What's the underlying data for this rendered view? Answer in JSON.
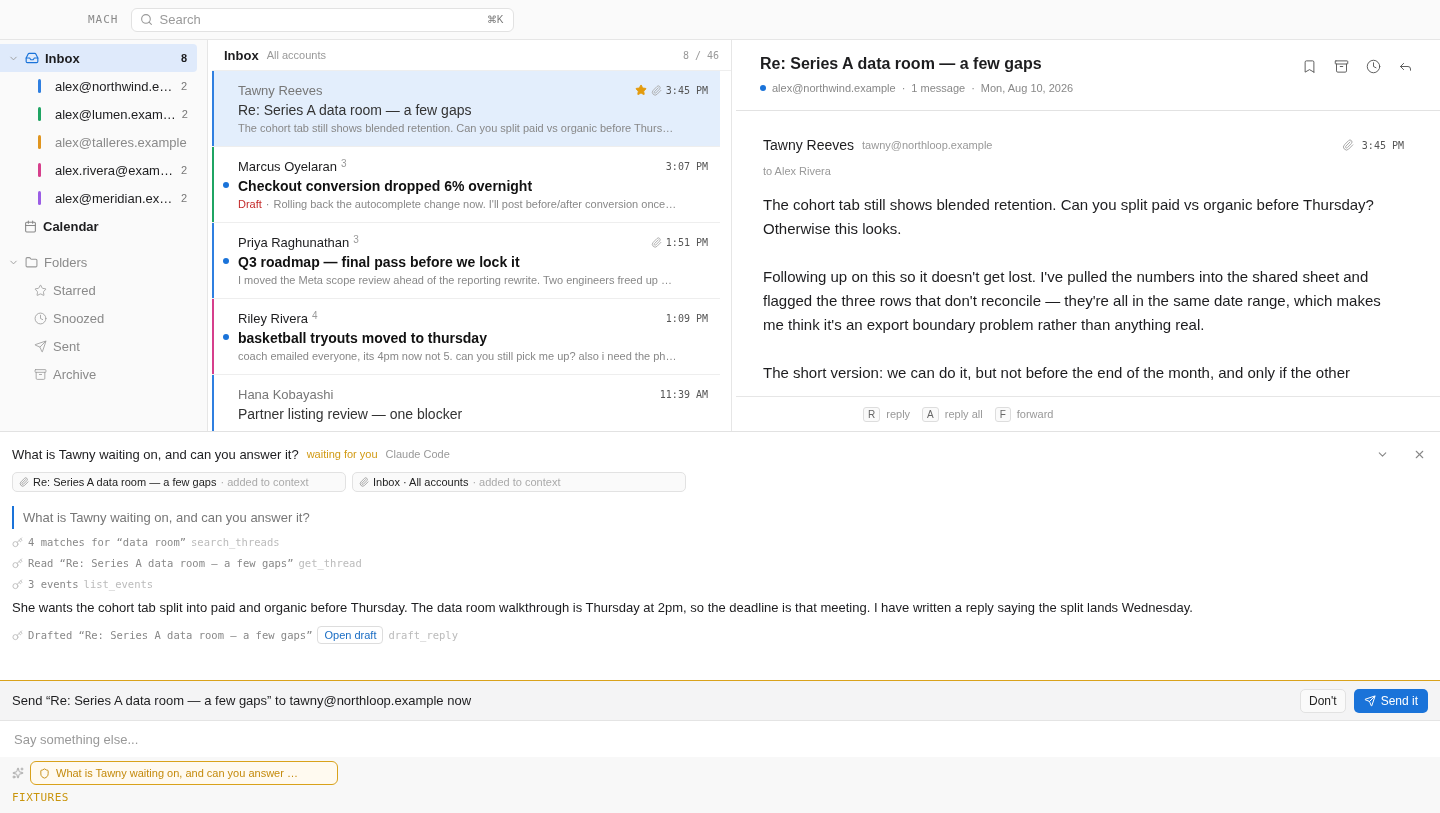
{
  "app": {
    "name": "MACH"
  },
  "search": {
    "placeholder": "Search",
    "shortcut": "⌘K"
  },
  "sidebar": {
    "inbox": {
      "label": "Inbox",
      "count": "8",
      "expanded": true,
      "selected": true
    },
    "accounts": [
      {
        "label": "alex@northwind.e…",
        "count": "2",
        "color": "#2f7fe0",
        "unread": true
      },
      {
        "label": "alex@lumen.exam…",
        "count": "2",
        "color": "#1fa463",
        "unread": true
      },
      {
        "label": "alex@talleres.example",
        "color": "#e0951f",
        "unread": false
      },
      {
        "label": "alex.rivera@exam…",
        "count": "2",
        "color": "#d63f8c",
        "unread": true
      },
      {
        "label": "alex@meridian.ex…",
        "count": "2",
        "color": "#9b5de5",
        "unread": true
      }
    ],
    "calendar": {
      "label": "Calendar"
    },
    "folders": {
      "label": "Folders",
      "expanded": true,
      "items": [
        {
          "kind": "starred",
          "label": "Starred"
        },
        {
          "kind": "snoozed",
          "label": "Snoozed"
        },
        {
          "kind": "sent",
          "label": "Sent"
        },
        {
          "kind": "archive",
          "label": "Archive"
        }
      ]
    }
  },
  "list": {
    "title": "Inbox",
    "scope": "All accounts",
    "counter": "8 / 46",
    "threads": [
      {
        "sender": "Tawny Reeves",
        "time": "3:45 PM",
        "subject": "Re: Series A data room — a few gaps",
        "preview": "The cohort tab still shows blended retention. Can you split paid vs organic before Thurs…",
        "starred": true,
        "attachment": true,
        "unread": false,
        "selected": true,
        "color": "#2f7fe0"
      },
      {
        "sender": "Marcus Oyelaran",
        "count": "3",
        "time": "3:07 PM",
        "subject": "Checkout conversion dropped 6% overnight",
        "draft_label": "Draft",
        "draft_separator": "·",
        "preview": "Rolling back the autocomplete change now. I'll post before/after conversion once…",
        "starred": false,
        "attachment": false,
        "unread": true,
        "selected": false,
        "color": "#1fa463"
      },
      {
        "sender": "Priya Raghunathan",
        "count": "3",
        "time": "1:51 PM",
        "subject": "Q3 roadmap — final pass before we lock it",
        "preview": "I moved the Meta scope review ahead of the reporting rewrite. Two engineers freed up …",
        "starred": false,
        "attachment": true,
        "unread": true,
        "selected": false,
        "color": "#2f7fe0"
      },
      {
        "sender": "Riley Rivera",
        "count": "4",
        "time": "1:09 PM",
        "subject": "basketball tryouts moved to thursday",
        "preview": "coach emailed everyone, its 4pm now not 5. can you still pick me up? also i need the ph…",
        "starred": false,
        "attachment": false,
        "unread": true,
        "selected": false,
        "color": "#d63f8c"
      },
      {
        "sender": "Hana Kobayashi",
        "time": "11:39 AM",
        "subject": "Partner listing review — one blocker",
        "starred": false,
        "attachment": false,
        "unread": false,
        "selected": false,
        "color": "#2f7fe0"
      }
    ]
  },
  "reader": {
    "subject": "Re: Series A data room — a few gaps",
    "account": "alex@northwind.example",
    "separator": "·",
    "messages": "1 message",
    "date": "Mon, Aug 10, 2026",
    "sender": "Tawny Reeves",
    "sender_email": "tawny@northloop.example",
    "time": "3:45 PM",
    "attachment": true,
    "to": "to Alex Rivera",
    "paragraphs": [
      "The cohort tab still shows blended retention. Can you split paid vs organic before Thursday? Otherwise this looks.",
      "Following up on this so it doesn't get lost. I've pulled the numbers into the shared sheet and flagged the three rows that don't reconcile — they're all in the same date range, which makes me think it's an export boundary problem rather than anything real.",
      "The short version: we can do it, but not before the end of the month, and only if the other"
    ],
    "shortcuts": [
      {
        "key": "R",
        "label": "reply"
      },
      {
        "key": "A",
        "label": "reply all"
      },
      {
        "key": "F",
        "label": "forward"
      }
    ]
  },
  "assistant": {
    "question": "What is Tawny waiting on, and can you answer it?",
    "status": "waiting for you",
    "agent": "Claude Code",
    "context": [
      {
        "label": "Re: Series A data room — a few gaps",
        "note": "· added to context"
      },
      {
        "label": "Inbox · All accounts",
        "note": "· added to context"
      }
    ],
    "quote": "What is Tawny waiting on, and can you answer it?",
    "steps": [
      {
        "text": "4 matches for “data room”",
        "tool": "search_threads"
      },
      {
        "text": "Read “Re: Series A data room — a few gaps”",
        "tool": "get_thread"
      },
      {
        "text": "3 events",
        "tool": "list_events"
      }
    ],
    "answer": "She wants the cohort tab split into paid and organic before Thursday. The data room walkthrough is Thursday at 2pm, so the deadline is that meeting. I have written a reply saying the split lands Wednesday.",
    "draft_step": {
      "text": "Drafted “Re: Series A data room — a few gaps”",
      "action": "Open draft",
      "tool": "draft_reply"
    },
    "confirm": {
      "text": "Send “Re: Series A data room — a few gaps” to tawny@northloop.example now",
      "decline": "Don't",
      "accept": "Send it"
    },
    "input": {
      "placeholder": "Say something else..."
    },
    "chip": "What is Tawny waiting on, and can you answer …",
    "footer": "FIXTURES"
  }
}
